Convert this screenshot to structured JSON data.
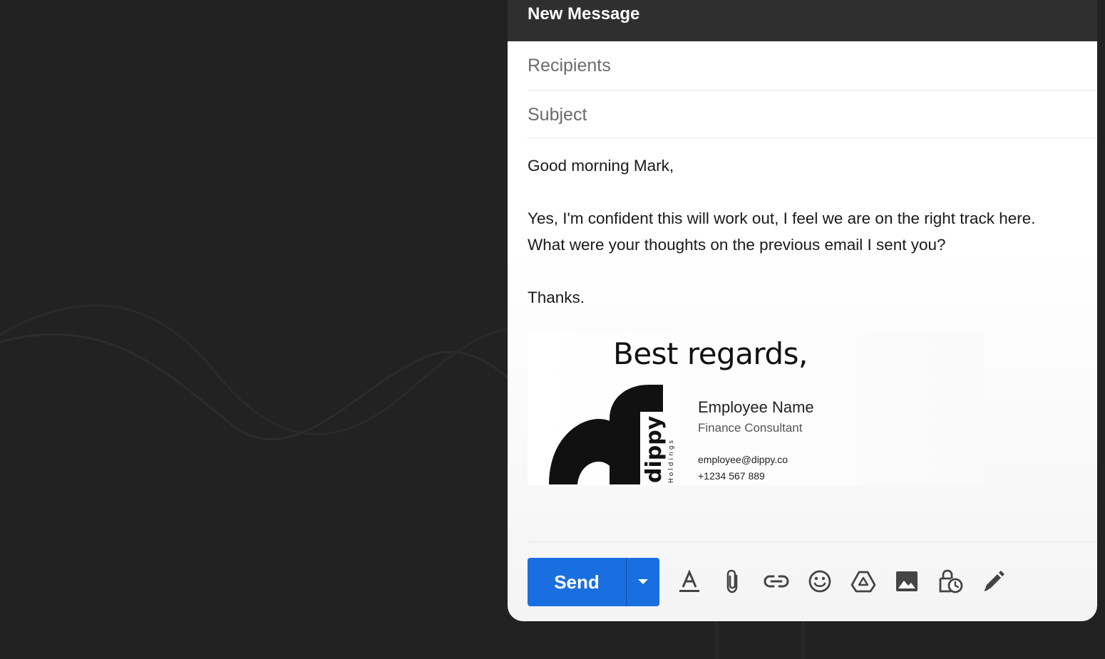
{
  "compose": {
    "title": "New Message",
    "recipients_placeholder": "Recipients",
    "subject_placeholder": "Subject",
    "body": {
      "greeting": "Good morning Mark,",
      "line1": "Yes, I'm confident this will work out, I feel we are on the right track here.",
      "line2": "What were your thoughts on the previous email I sent you?",
      "closing": "Thanks."
    }
  },
  "signature": {
    "regards": "Best regards,",
    "logo_word": "dippy",
    "logo_sub": "Holdings",
    "name": "Employee Name",
    "title": "Finance Consultant",
    "email": "employee@dippy.co",
    "phone": "+1234 567 889"
  },
  "toolbar": {
    "send_label": "Send",
    "icons": [
      "format-text-icon",
      "attach-icon",
      "link-icon",
      "emoji-icon",
      "drive-icon",
      "photo-icon",
      "confidential-mode-icon",
      "signature-pen-icon"
    ]
  },
  "colors": {
    "send_button": "#1a6fe0",
    "header": "#2f2f2f",
    "background": "#222222"
  }
}
